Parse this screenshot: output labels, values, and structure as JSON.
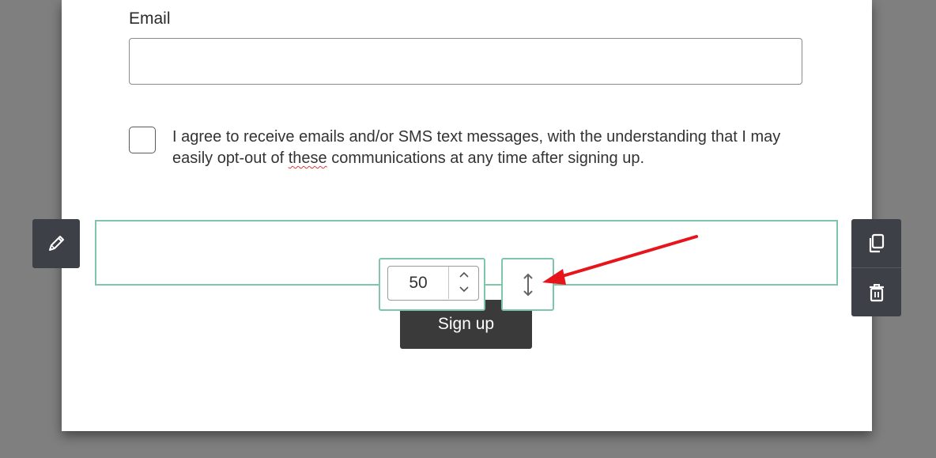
{
  "form": {
    "email_label": "Email",
    "email_value": "",
    "consent_text_before": "I agree to receive emails and/or SMS text messages, with the understanding that I may easily opt-out of ",
    "consent_text_misspelled": "these",
    "consent_text_after": " communications at any time after signing up.",
    "signup_label": "Sign up"
  },
  "spacer": {
    "height_value": "50"
  },
  "toolbar": {
    "edit_icon": "pencil-icon",
    "duplicate_icon": "copy-icon",
    "delete_icon": "trash-icon",
    "resize_icon": "vertical-resize-icon"
  },
  "colors": {
    "selection_accent": "#7dc6aa",
    "toolbar_bg": "#3d4047",
    "button_bg": "#3a3a3a",
    "annotation_arrow": "#e8141b"
  }
}
